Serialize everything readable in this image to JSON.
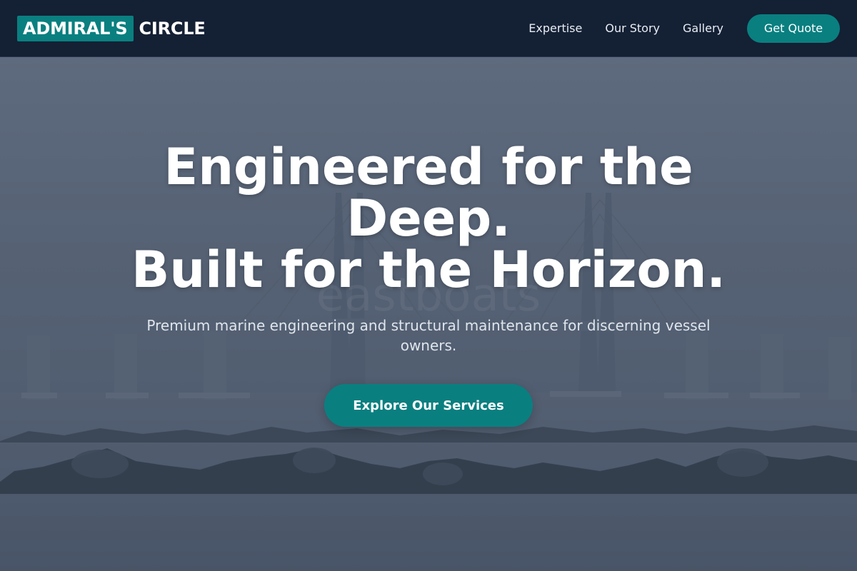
{
  "brand": {
    "mark": "ADMIRAL'S",
    "word": "CIRCLE"
  },
  "nav": {
    "links": [
      "Expertise",
      "Our Story",
      "Gallery"
    ],
    "cta_label": "Get Quote"
  },
  "hero": {
    "title_line1": "Engineered for the",
    "title_line2": "Deep.",
    "title_line3": "Built for the Horizon.",
    "subtitle": "Premium marine engineering and structural maintenance for discerning vessel owners.",
    "cta_label": "Explore Our Services",
    "background_watermark": "eastboats"
  },
  "colors": {
    "header_bg": "#142034",
    "accent": "#0a7f80",
    "hero_overlay": "#4e5b6d"
  }
}
